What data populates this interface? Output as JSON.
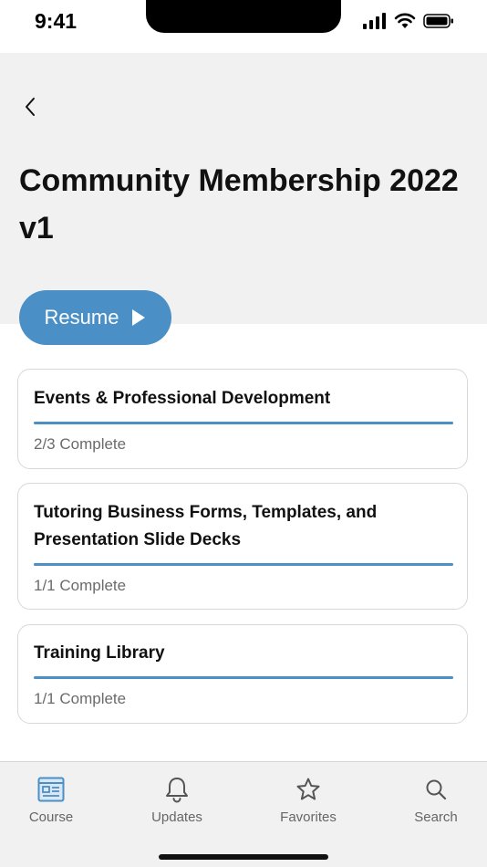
{
  "status_bar": {
    "time": "9:41"
  },
  "header": {
    "title": "Community Membership 2022 v1"
  },
  "resume": {
    "label": "Resume"
  },
  "cards": [
    {
      "title": "Events & Professional Development",
      "status": "2/3 Complete",
      "progress": 1.0
    },
    {
      "title": "Tutoring Business Forms, Templates, and Presentation Slide Decks",
      "status": "1/1 Complete",
      "progress": 1.0
    },
    {
      "title": "Training Library",
      "status": "1/1 Complete",
      "progress": 1.0
    }
  ],
  "tabs": [
    {
      "label": "Course",
      "icon": "course-icon",
      "active": true
    },
    {
      "label": "Updates",
      "icon": "bell-icon"
    },
    {
      "label": "Favorites",
      "icon": "star-icon"
    },
    {
      "label": "Search",
      "icon": "search-icon"
    }
  ],
  "colors": {
    "accent": "#4a8fc6",
    "header_bg": "#f1f1f1",
    "tab_bar_bg": "#f1f1f1"
  }
}
